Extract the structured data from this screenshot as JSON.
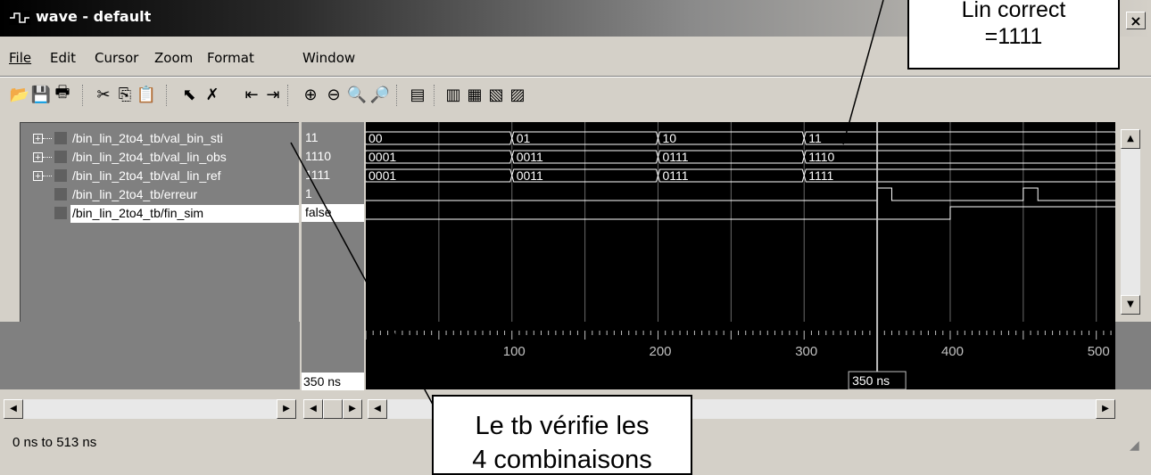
{
  "window": {
    "title": "wave - default",
    "close_label": "×"
  },
  "menu": [
    {
      "label": "File"
    },
    {
      "label": "Edit"
    },
    {
      "label": "Cursor"
    },
    {
      "label": "Zoom"
    },
    {
      "label": "Format"
    },
    {
      "label": "Window"
    }
  ],
  "toolbar": [
    "open-icon",
    "save-icon",
    "print-icon",
    "cut-icon",
    "copy-icon",
    "paste-icon",
    "select-pointer-icon",
    "clear-icon",
    "find-prev-edge-icon",
    "find-next-edge-icon",
    "zoom-in-icon",
    "zoom-out-icon",
    "zoom-full-icon",
    "zoom-to-cursor-icon",
    "insert-cursor-icon",
    "wave-list-1-icon",
    "wave-list-2-icon",
    "wave-list-3-icon",
    "delete-cursor-icon"
  ],
  "signals": [
    {
      "name": "/bin_lin_2to4_tb/val_bin_sti",
      "value": "11",
      "expandable": true,
      "expander": "+"
    },
    {
      "name": "/bin_lin_2to4_tb/val_lin_obs",
      "value": "1110",
      "expandable": true,
      "expander": "+"
    },
    {
      "name": "/bin_lin_2to4_tb/val_lin_ref",
      "value": "1111",
      "expandable": true,
      "expander": "+"
    },
    {
      "name": "/bin_lin_2to4_tb/erreur",
      "value": "1",
      "expandable": false
    },
    {
      "name": "/bin_lin_2to4_tb/fin_sim",
      "value": "false",
      "expandable": false,
      "selected": true
    }
  ],
  "waves": {
    "time_range": [
      0,
      513
    ],
    "buses": [
      {
        "values": [
          "00",
          "01",
          "10",
          "11"
        ],
        "times": [
          0,
          100,
          200,
          300
        ]
      },
      {
        "values": [
          "0001",
          "0011",
          "0111",
          "1110"
        ],
        "times": [
          0,
          100,
          200,
          300
        ]
      },
      {
        "values": [
          "0001",
          "0011",
          "0111",
          "1111"
        ],
        "times": [
          0,
          100,
          200,
          300
        ]
      }
    ],
    "erreur_pulses": [
      [
        350,
        360
      ],
      [
        450,
        460
      ]
    ],
    "fin_sim_high_from": 400
  },
  "timeline": {
    "ticks": [
      "100",
      "200",
      "300",
      "400",
      "500"
    ],
    "tick_times": [
      100,
      200,
      300,
      400,
      500
    ]
  },
  "cursor": {
    "time_ns": 350,
    "label": "350 ns",
    "value_label": "350 ns"
  },
  "status": {
    "text": "0 ns to 513 ns"
  },
  "callouts": {
    "lin_correct": "Lin correct\n=1111",
    "tb_verifie": "Le tb vérifie les\n4 combinaisons"
  },
  "colors": {
    "wave": "#ffffff",
    "background": "#000000",
    "cursor": "#c0c0c0"
  }
}
